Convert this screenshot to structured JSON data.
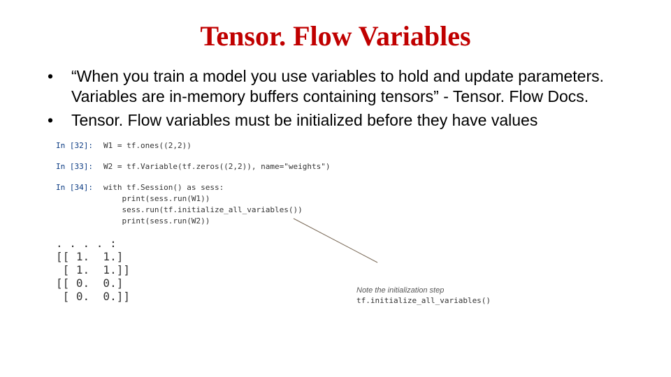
{
  "title": "Tensor. Flow Variables",
  "bullets": [
    "“When you train a model you use variables to hold and update parameters. Variables are in-memory buffers containing tensors” - Tensor. Flow Docs.",
    "Tensor. Flow variables must be initialized before they have values"
  ],
  "code": {
    "cells": [
      {
        "prompt": "In [32]:",
        "lines": [
          "W1 = tf.ones((2,2))"
        ]
      },
      {
        "prompt": "In [33]:",
        "lines": [
          "W2 = tf.Variable(tf.zeros((2,2)), name=\"weights\")"
        ]
      },
      {
        "prompt": "In [34]:",
        "lines": [
          "with tf.Session() as sess:",
          "    print(sess.run(W1))",
          "    sess.run(tf.initialize_all_variables())",
          "    print(sess.run(W2))"
        ]
      }
    ],
    "output": [
      ". . . . :",
      "[[ 1.  1.]",
      " [ 1.  1.]]",
      "[[ 0.  0.]",
      " [ 0.  0.]]"
    ]
  },
  "note": {
    "text": "Note the initialization step",
    "mono": "tf.initialize_all_variables()"
  }
}
